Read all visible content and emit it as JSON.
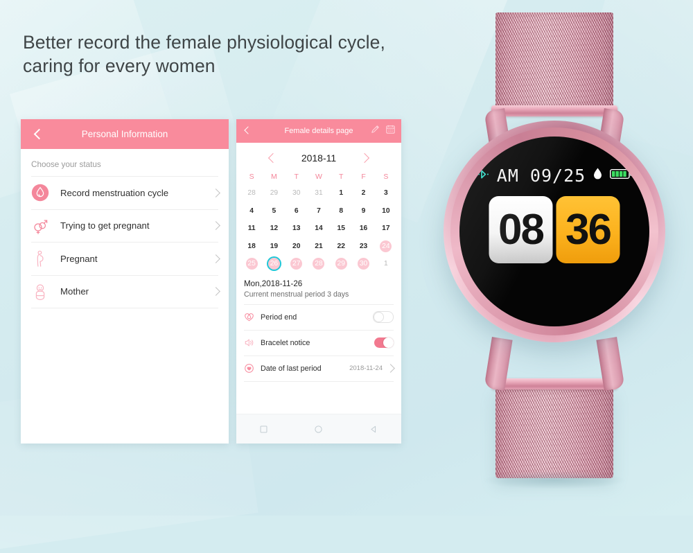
{
  "headline": {
    "line1": "Better record the female physiological cycle,",
    "line2": "caring for every women"
  },
  "colors": {
    "background": "#d4ecf0",
    "pink_bar": "#f98b9c",
    "pink_accent": "#f4869a",
    "highlight_pill": "#fbc8d2",
    "today_ring": "#1fc8d8",
    "toggle_on": "#f2798f",
    "watch_minute_card": "#fcb21e",
    "watch_bluetooth": "#2fd9c5",
    "watch_battery": "#3ddc62"
  },
  "phone_personal": {
    "appbar": {
      "back_icon": "chevron-left-icon",
      "title": "Personal Information"
    },
    "section_label": "Choose your status",
    "items": [
      {
        "label": "Record menstruation cycle",
        "icon": "menstruation-drop-icon"
      },
      {
        "label": "Trying to get pregnant",
        "icon": "gender-symbols-icon"
      },
      {
        "label": "Pregnant",
        "icon": "pregnant-woman-icon"
      },
      {
        "label": "Mother",
        "icon": "baby-icon"
      }
    ]
  },
  "phone_female": {
    "appbar": {
      "back_icon": "chevron-left-icon",
      "title": "Female details page",
      "actions": [
        "edit-pen-icon",
        "calendar-icon"
      ]
    },
    "calendar": {
      "prev_icon": "chevron-left-icon",
      "month_label": "2018-11",
      "next_icon": "chevron-right-icon",
      "day_headers": [
        "S",
        "M",
        "T",
        "W",
        "T",
        "F",
        "S"
      ],
      "weeks": [
        [
          {
            "d": "28",
            "s": "mute"
          },
          {
            "d": "29",
            "s": "mute"
          },
          {
            "d": "30",
            "s": "mute"
          },
          {
            "d": "31",
            "s": "mute"
          },
          {
            "d": "1",
            "s": "normal"
          },
          {
            "d": "2",
            "s": "normal"
          },
          {
            "d": "3",
            "s": "normal"
          }
        ],
        [
          {
            "d": "4",
            "s": "normal"
          },
          {
            "d": "5",
            "s": "normal"
          },
          {
            "d": "6",
            "s": "normal"
          },
          {
            "d": "7",
            "s": "normal"
          },
          {
            "d": "8",
            "s": "normal"
          },
          {
            "d": "9",
            "s": "normal"
          },
          {
            "d": "10",
            "s": "normal"
          }
        ],
        [
          {
            "d": "11",
            "s": "normal"
          },
          {
            "d": "12",
            "s": "normal"
          },
          {
            "d": "13",
            "s": "normal"
          },
          {
            "d": "14",
            "s": "normal"
          },
          {
            "d": "15",
            "s": "normal"
          },
          {
            "d": "16",
            "s": "normal"
          },
          {
            "d": "17",
            "s": "normal"
          }
        ],
        [
          {
            "d": "18",
            "s": "normal"
          },
          {
            "d": "19",
            "s": "normal"
          },
          {
            "d": "20",
            "s": "normal"
          },
          {
            "d": "21",
            "s": "normal"
          },
          {
            "d": "22",
            "s": "normal"
          },
          {
            "d": "23",
            "s": "normal"
          },
          {
            "d": "24",
            "s": "highlight"
          }
        ],
        [
          {
            "d": "25",
            "s": "highlight"
          },
          {
            "d": "26",
            "s": "today"
          },
          {
            "d": "27",
            "s": "highlight"
          },
          {
            "d": "28",
            "s": "highlight"
          },
          {
            "d": "29",
            "s": "highlight"
          },
          {
            "d": "30",
            "s": "highlight"
          },
          {
            "d": "1",
            "s": "mute"
          }
        ]
      ]
    },
    "selected_date": "Mon,2018-11-26",
    "selected_note": "Current menstrual period 3 days",
    "settings": [
      {
        "label": "Period end",
        "icon": "heart-drop-icon",
        "control": "toggle",
        "value": "off"
      },
      {
        "label": "Bracelet notice",
        "icon": "speaker-icon",
        "control": "toggle",
        "value": "on"
      },
      {
        "label": "Date of last period",
        "icon": "heart-shield-icon",
        "control": "value",
        "value": "2018-11-24"
      }
    ],
    "navbar": [
      "recents-square-icon",
      "home-circle-icon",
      "back-triangle-icon"
    ]
  },
  "watch": {
    "status": {
      "bluetooth_icon": "bluetooth-icon",
      "meridiem": "AM",
      "date": "09/25",
      "water_icon": "water-drop-icon",
      "battery_icon": "battery-full-icon"
    },
    "time": {
      "hours": "08",
      "minutes": "36"
    }
  }
}
